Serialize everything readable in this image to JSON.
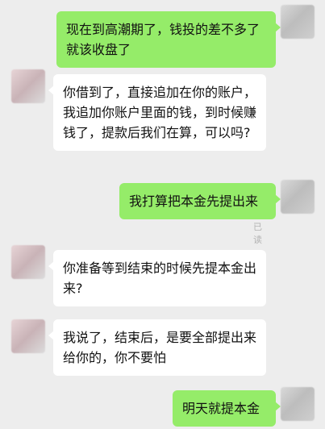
{
  "messages": [
    {
      "side": "right",
      "text": "现在到高潮期了，钱投的差不多了就该收盘了"
    },
    {
      "side": "left",
      "text": "你借到了，直接追加在你的账户，我追加你账户里面的钱，到时候赚钱了，提款后我们在算，可以吗?"
    },
    {
      "side": "right",
      "text": "我打算把本金先提出来",
      "status": "已读"
    },
    {
      "side": "left",
      "text": "你准备等到结束的时候先提本金出来?"
    },
    {
      "side": "left",
      "text": "我说了，结束后，是要全部提出来给你的，你不要怕"
    },
    {
      "side": "right",
      "text": "明天就提本金"
    }
  ]
}
